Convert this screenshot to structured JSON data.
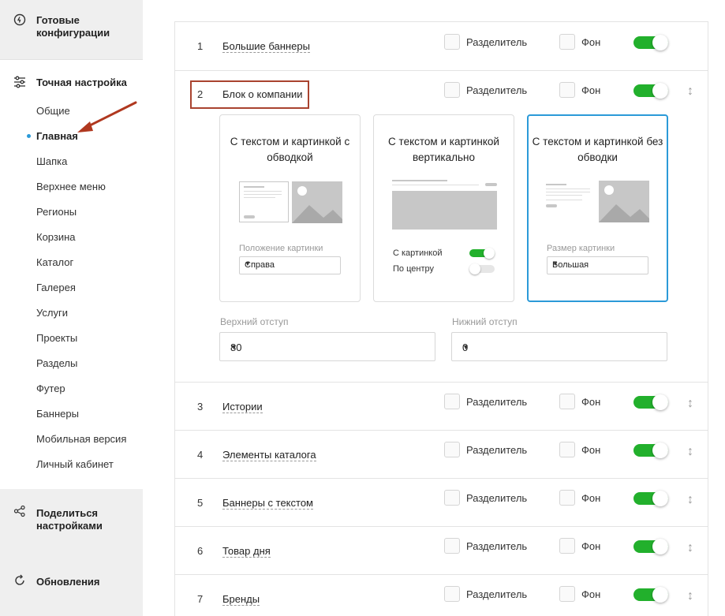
{
  "sidebar": {
    "ready_configs": "Готовые конфигурации",
    "fine_tuning": "Точная настройка",
    "menu": [
      "Общие",
      "Главная",
      "Шапка",
      "Верхнее меню",
      "Регионы",
      "Корзина",
      "Каталог",
      "Галерея",
      "Услуги",
      "Проекты",
      "Разделы",
      "Футер",
      "Баннеры",
      "Мобильная версия",
      "Личный кабинет"
    ],
    "active_index": 1,
    "share": "Поделиться настройками",
    "updates": "Обновления"
  },
  "labels": {
    "divider": "Разделитель",
    "background": "Фон"
  },
  "rows": [
    {
      "num": "1",
      "name": "Большие баннеры"
    },
    {
      "num": "2",
      "name": "Блок о компании"
    },
    {
      "num": "3",
      "name": "Истории"
    },
    {
      "num": "4",
      "name": "Элементы каталога"
    },
    {
      "num": "5",
      "name": "Баннеры с текстом"
    },
    {
      "num": "6",
      "name": "Товар дня"
    },
    {
      "num": "7",
      "name": "Бренды"
    }
  ],
  "cards": [
    {
      "title": "С текстом и картинкой с обводкой",
      "option_label": "Положение картинки",
      "option_value": "Справа"
    },
    {
      "title": "С текстом и картинкой вертикально",
      "toggle1": "С картинкой",
      "toggle2": "По центру"
    },
    {
      "title": "С текстом и картинкой без обводки",
      "option_label": "Размер картинки",
      "option_value": "Большая"
    }
  ],
  "padding": {
    "top_label": "Верхний отступ",
    "top_value": "80",
    "bottom_label": "Нижний отступ",
    "bottom_value": "0"
  },
  "colors": {
    "accent": "#22b02c",
    "selected_border": "#2b9ad8",
    "highlight": "#a9432f"
  }
}
